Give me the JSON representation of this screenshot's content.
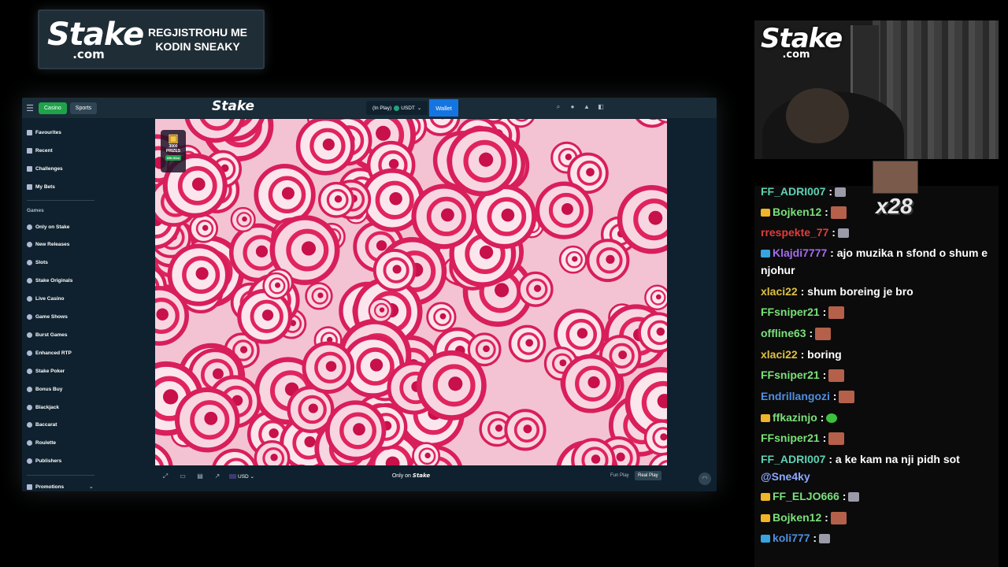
{
  "promo": {
    "logo_word": "Stake",
    "logo_domain": ".com",
    "text": "REGJISTROHU ME KODIN SNEAKY"
  },
  "topbar": {
    "casino_tab": "Casino",
    "sports_tab": "Sports",
    "logo": "Stake",
    "in_play": "(In Play)",
    "currency": "USDT",
    "wallet_label": "Wallet"
  },
  "sidebar": {
    "top_items": [
      "Favourites",
      "Recent",
      "Challenges",
      "My Bets"
    ],
    "games_heading": "Games",
    "game_items": [
      "Only on Stake",
      "New Releases",
      "Slots",
      "Stake Originals",
      "Live Casino",
      "Game Shows",
      "Burst Games",
      "Enhanced RTP",
      "Stake Poker",
      "Bonus Buy",
      "Blackjack",
      "Baccarat",
      "Roulette",
      "Publishers"
    ],
    "promotions": "Promotions"
  },
  "game": {
    "gift_count": "3000",
    "gift_label": "PRIZES",
    "gift_timer": "09h 51m"
  },
  "footer": {
    "currency": "USD",
    "only_on": "Only on",
    "only_on_brand": "Stake",
    "fun_play": "Fun Play",
    "real_play": "Real Play"
  },
  "webcam": {
    "logo_word": "Stake",
    "logo_domain": ".com"
  },
  "emote_multiplier": "x28",
  "chat": [
    {
      "user": "FF_ADRI007",
      "color": "#5fd1b4",
      "text": ":",
      "emote": "small",
      "badge": ""
    },
    {
      "user": "Bojken12",
      "color": "#7ae07a",
      "text": ":",
      "emote": "face",
      "badge": "crown"
    },
    {
      "user": "rrespekte_77",
      "color": "#e03c3c",
      "text": ":",
      "emote": "small",
      "badge": ""
    },
    {
      "user": "Klajdi7777",
      "color": "#a56cf0",
      "text": ": ajo muzika n sfond o shum e",
      "emote": "",
      "badge": "sub"
    },
    {
      "user": "",
      "color": "#ffffff",
      "text": "njohur",
      "emote": "",
      "badge": ""
    },
    {
      "user": "xlaci22",
      "color": "#e0c040",
      "text": ": shum boreing je bro",
      "emote": "",
      "badge": ""
    },
    {
      "user": "FFsniper21",
      "color": "#7ae07a",
      "text": ":",
      "emote": "face",
      "badge": ""
    },
    {
      "user": "offline63",
      "color": "#7ae07a",
      "text": ":",
      "emote": "face",
      "badge": ""
    },
    {
      "user": "xlaci22",
      "color": "#e0c040",
      "text": ": boring",
      "emote": "",
      "badge": ""
    },
    {
      "user": "FFsniper21",
      "color": "#7ae07a",
      "text": ":",
      "emote": "face",
      "badge": ""
    },
    {
      "user": "Endrillangozi",
      "color": "#4f8fe0",
      "text": ":",
      "emote": "face",
      "badge": ""
    },
    {
      "user": "ffkazinjo",
      "color": "#7ae07a",
      "text": ":",
      "emote": "green",
      "badge": "crown"
    },
    {
      "user": "FFsniper21",
      "color": "#7ae07a",
      "text": ":",
      "emote": "face",
      "badge": ""
    },
    {
      "user": "FF_ADRI007",
      "color": "#5fd1b4",
      "text": ": a ke kam na nji pidh sot",
      "emote": "",
      "badge": ""
    },
    {
      "user": "",
      "color": "#8aa8ff",
      "text": "@Sne4ky",
      "emote": "",
      "badge": ""
    },
    {
      "user": "FF_ELJO666",
      "color": "#7ae07a",
      "text": ":",
      "emote": "small",
      "badge": "crown"
    },
    {
      "user": "Bojken12",
      "color": "#7ae07a",
      "text": ":",
      "emote": "face",
      "badge": "crown"
    },
    {
      "user": "koli777",
      "color": "#4f8fe0",
      "text": ":",
      "emote": "small",
      "badge": "sub"
    }
  ]
}
